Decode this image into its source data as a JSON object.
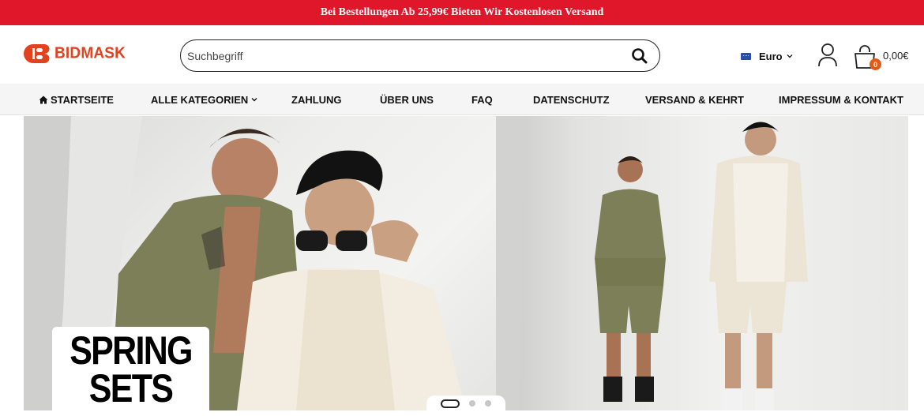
{
  "announcement": "Bei Bestellungen Ab 25,99€ Bieten Wir Kostenlosen Versand",
  "logo": {
    "text": "BIDMASK",
    "brand_color": "#e3421f"
  },
  "search": {
    "placeholder": "Suchbegriff",
    "value": ""
  },
  "currency": {
    "label": "Euro",
    "flag": "eu-flag-icon"
  },
  "cart": {
    "count": "0",
    "total": "0,00€"
  },
  "nav": {
    "items": [
      {
        "label": "STARTSEITE",
        "icon": "home-icon"
      },
      {
        "label": "ALLE KATEGORIEN",
        "icon": "chevron-down-icon"
      },
      {
        "label": "ZAHLUNG"
      },
      {
        "label": "ÜBER UNS"
      },
      {
        "label": "FAQ"
      },
      {
        "label": "DATENSCHUTZ"
      },
      {
        "label": "VERSAND & KEHRT"
      },
      {
        "label": "IMPRESSUM & KONTAKT"
      }
    ]
  },
  "hero": {
    "promo_line1": "SPRING",
    "promo_line2": "SETS",
    "slides": 3,
    "active_slide": 1
  },
  "colors": {
    "announcement_bg": "#e0162b",
    "accent": "#e35a14",
    "nav_bg": "#f5f5f5"
  }
}
